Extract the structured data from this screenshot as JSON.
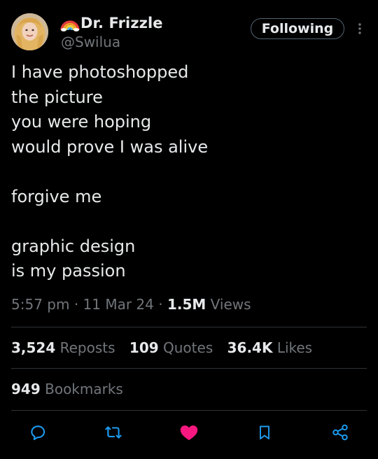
{
  "author": {
    "display_name": "Dr. Frizzle",
    "handle": "@Swilua",
    "emoji_icon": "rainbow-icon"
  },
  "follow_button": {
    "label": "Following"
  },
  "tweet": {
    "lines": [
      "I have photoshopped",
      "the picture",
      "you were hoping",
      "would prove I was alive",
      "",
      "forgive me",
      "",
      "graphic design",
      "is my passion"
    ]
  },
  "meta": {
    "time": "5:57 pm",
    "separator": "·",
    "date": "11 Mar 24",
    "views_count": "1.5M",
    "views_label": "Views"
  },
  "stats": {
    "reposts_count": "3,524",
    "reposts_label": "Reposts",
    "quotes_count": "109",
    "quotes_label": "Quotes",
    "likes_count": "36.4K",
    "likes_label": "Likes",
    "bookmarks_count": "949",
    "bookmarks_label": "Bookmarks"
  },
  "actions": {
    "reply_icon": "reply-icon",
    "repost_icon": "repost-icon",
    "like_icon": "heart-icon",
    "bookmark_icon": "bookmark-icon",
    "share_icon": "share-icon"
  },
  "colors": {
    "background": "#000000",
    "text_primary": "#e7e9ea",
    "text_secondary": "#71767b",
    "divider": "#2f3336",
    "like_active": "#f91880",
    "icon_default": "#1d9bf0"
  }
}
